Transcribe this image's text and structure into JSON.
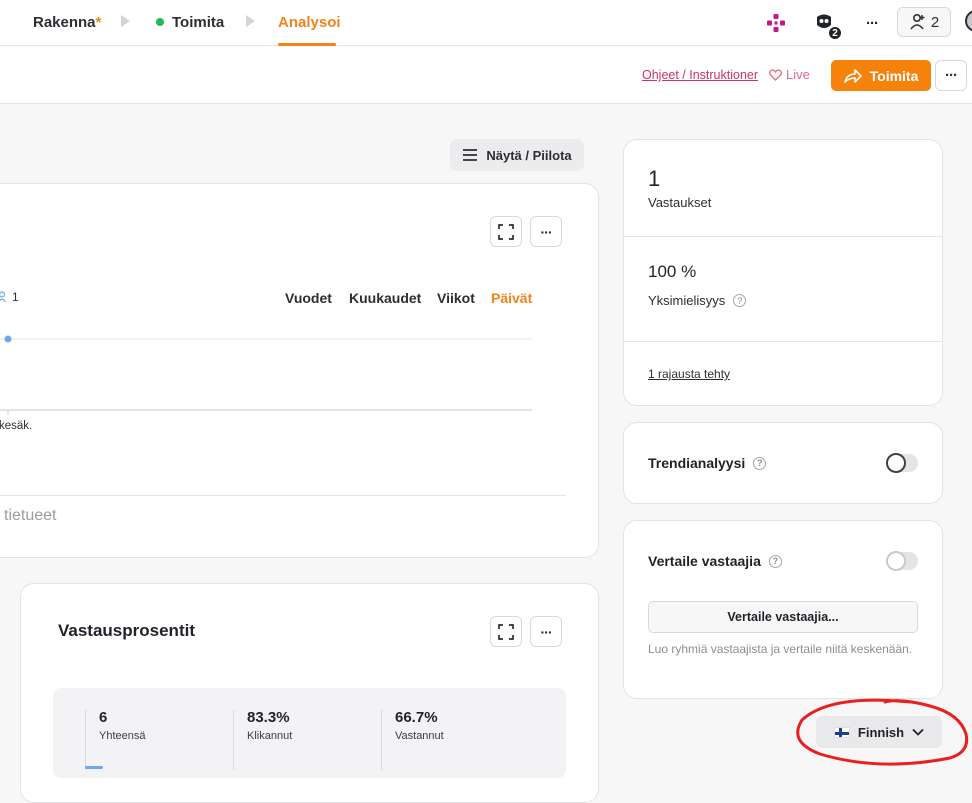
{
  "nav": {
    "steps": [
      {
        "label": "Rakenna",
        "marker": "*"
      },
      {
        "label": "Toimita"
      },
      {
        "label": "Analysoi"
      }
    ],
    "notification_count": "2",
    "collaborators_count": "2"
  },
  "toolbar": {
    "help_link": "Ohjeet / Instruktioner",
    "live_label": "Live",
    "share_label": "Toimita"
  },
  "showhide_label": "Näytä / Piilota",
  "timeline_card": {
    "respondent_count": "1",
    "periods": [
      "Vuodet",
      "Kuukaudet",
      "Viikot",
      "Päivät"
    ],
    "active_period": "Päivät",
    "x_tick": "kesäk.",
    "records_label": "tietueet"
  },
  "response_rates": {
    "title": "Vastausprosentit",
    "stats": [
      {
        "value": "6",
        "label": "Yhteensä"
      },
      {
        "value": "83.3%",
        "label": "Klikannut"
      },
      {
        "value": "66.7%",
        "label": "Vastannut"
      }
    ]
  },
  "summary": {
    "responses_value": "1",
    "responses_label": "Vastaukset",
    "agreement_value": "100 %",
    "agreement_label": "Yksimielisyys",
    "filter_link": "1 rajausta tehty"
  },
  "trend": {
    "label": "Trendianalyysi",
    "enabled": true
  },
  "compare": {
    "label": "Vertaile vastaajia",
    "enabled": false,
    "button_label": "Vertaile vastaajia...",
    "hint": "Luo ryhmiä vastaajista ja vertaile niitä keskenään."
  },
  "language": {
    "selected": "Finnish"
  },
  "colors": {
    "accent": "#f4820b",
    "link": "#d02f6e",
    "live": "#e26a86",
    "status_green": "#22b85a",
    "annotation": "#e8201f"
  }
}
